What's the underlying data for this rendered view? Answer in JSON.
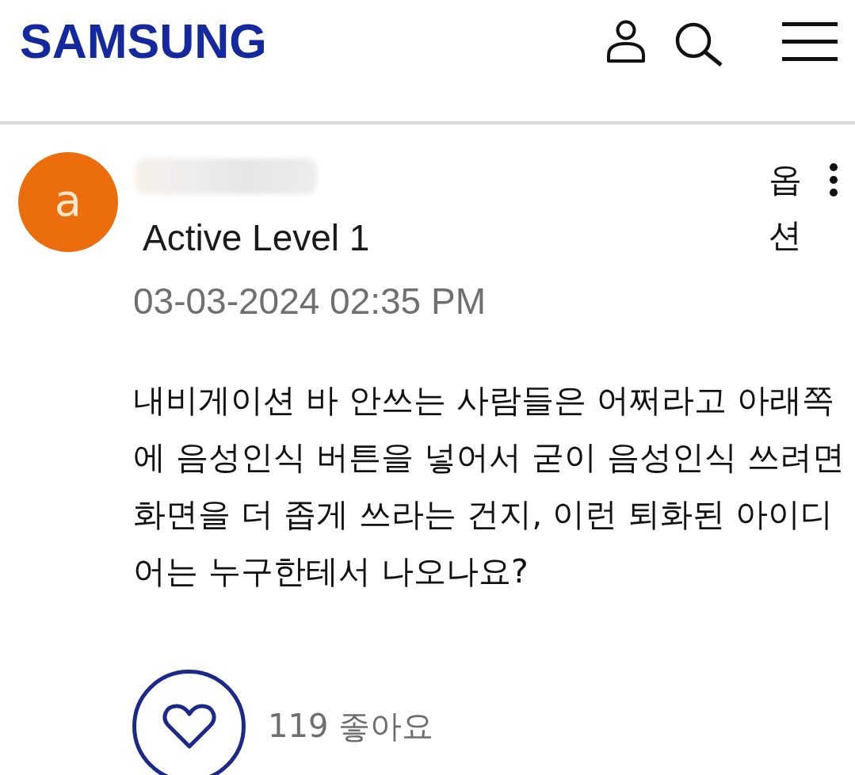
{
  "header": {
    "logo": "SAMSUNG"
  },
  "post": {
    "avatar_letter": "a",
    "author_badge": "Active Level 1",
    "options_label": "옵션",
    "timestamp": "03-03-2024 02:35 PM",
    "body": "내비게이션 바 안쓰는 사람들은 어쩌라고 아래쪽에 음성인식 버튼을 넣어서 굳이 음성인식 쓰려면 화면을 더 좁게 쓰라는 건지, 이런 퇴화된 아이디어는 누구한테서 나오나요?",
    "likes": {
      "liked": false,
      "count_label": "119 좋아요"
    }
  }
}
